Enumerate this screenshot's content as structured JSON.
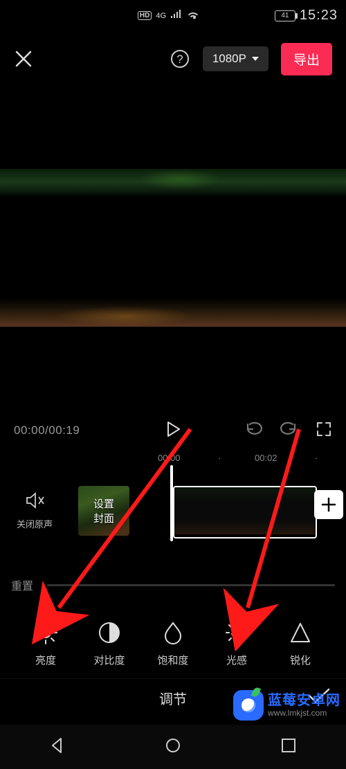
{
  "status": {
    "hd": "HD",
    "net": "4G",
    "battery": "41",
    "time": "15:23"
  },
  "topbar": {
    "resolution": "1080P",
    "export": "导出"
  },
  "playback": {
    "time": "00:00/00:19"
  },
  "timeline": {
    "ticks": [
      "00:00",
      "00:02"
    ],
    "mute_label": "关闭原声",
    "cover_label": "设置\n封面"
  },
  "adjust": {
    "reset": "重置",
    "tools": [
      {
        "key": "brightness",
        "label": "亮度"
      },
      {
        "key": "contrast",
        "label": "对比度"
      },
      {
        "key": "saturation",
        "label": "饱和度"
      },
      {
        "key": "light",
        "label": "光感"
      },
      {
        "key": "sharpen",
        "label": "锐化"
      }
    ]
  },
  "bottom": {
    "title": "调节"
  },
  "watermark": {
    "name": "蓝莓安卓网",
    "url": "www.lmkjst.com"
  }
}
